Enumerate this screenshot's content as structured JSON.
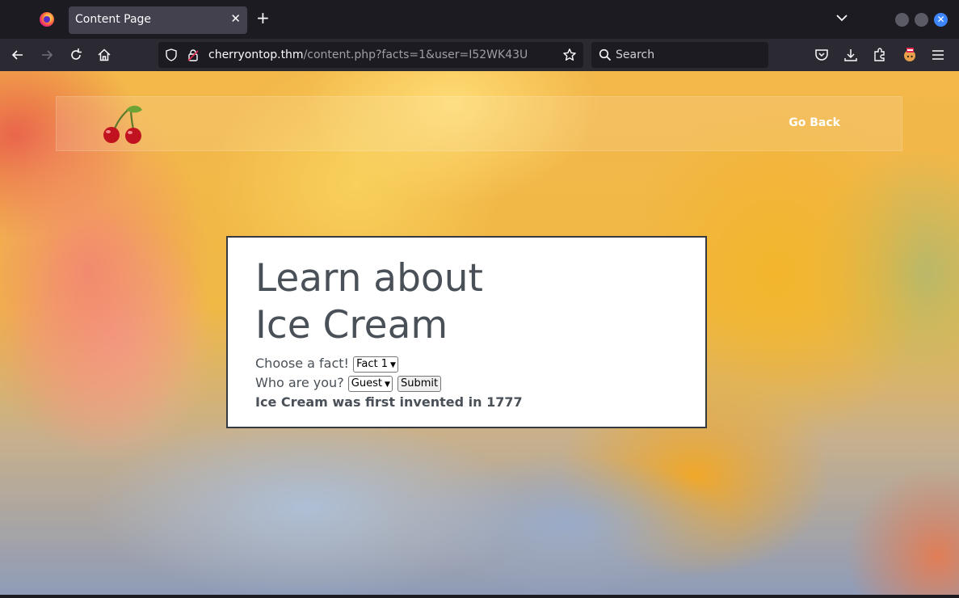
{
  "browser": {
    "tab_title": "Content Page",
    "tab_close": "✕",
    "new_tab": "+",
    "url_host": "cherryontop.thm",
    "url_path": "/content.php?facts=1&user=I52WK43U",
    "search_placeholder": "Search"
  },
  "site": {
    "nav_link": "Go Back",
    "logo_icon": "cherry-icon"
  },
  "card": {
    "title": "Learn about Ice Cream",
    "fact_label": "Choose a fact!",
    "fact_select_value": "Fact 1",
    "user_label": "Who are you?",
    "user_select_value": "Guest",
    "submit_label": "Submit",
    "fact_text": "Ice Cream was first invented in 1777"
  },
  "colors": {
    "chrome_dark": "#1c1b22",
    "toolbar": "#2b2a33",
    "accent_close": "#3d86ff",
    "card_text": "#495057"
  }
}
